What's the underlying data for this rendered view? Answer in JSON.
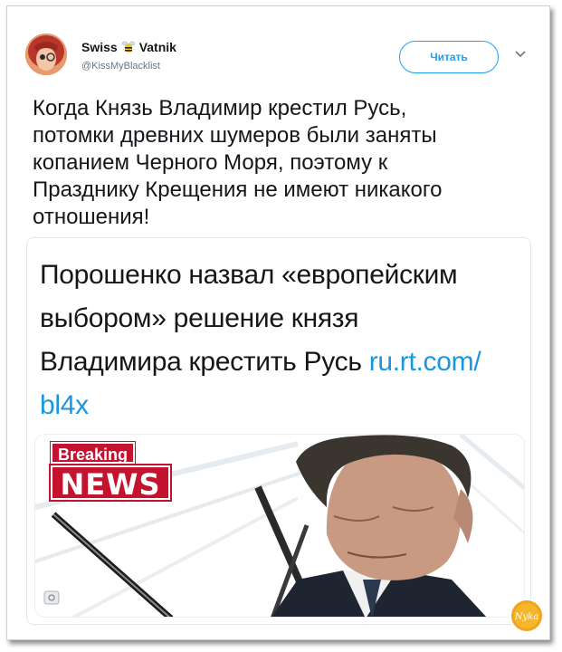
{
  "user": {
    "name_first": "Swiss",
    "name_second": "Vatnik",
    "handle": "@KissMyBlacklist",
    "avatar_icon": "avatar"
  },
  "follow_button": {
    "label": "Читать"
  },
  "tweet": {
    "lines": [
      "Когда Князь Владимир крестил Русь,",
      "потомки древних шумеров были заняты",
      "копанием Черного Моря, поэтому к",
      "Празднику Крещения не имеют никакого",
      "отношения!"
    ]
  },
  "card": {
    "line1": "Порошенко назвал «европейским",
    "line2": "выбором» решение князя",
    "line3": "Владимира крестить Русь ",
    "link_part1": "ru.rt.com/",
    "link_part2": "bl4x",
    "badge_top": "Breaking",
    "badge_bottom": "NEWS"
  },
  "watermark": {
    "text": "Nyka"
  },
  "colors": {
    "accent": "#1da1f2",
    "link": "#1b95e0",
    "badge_red": "#c4122f"
  }
}
